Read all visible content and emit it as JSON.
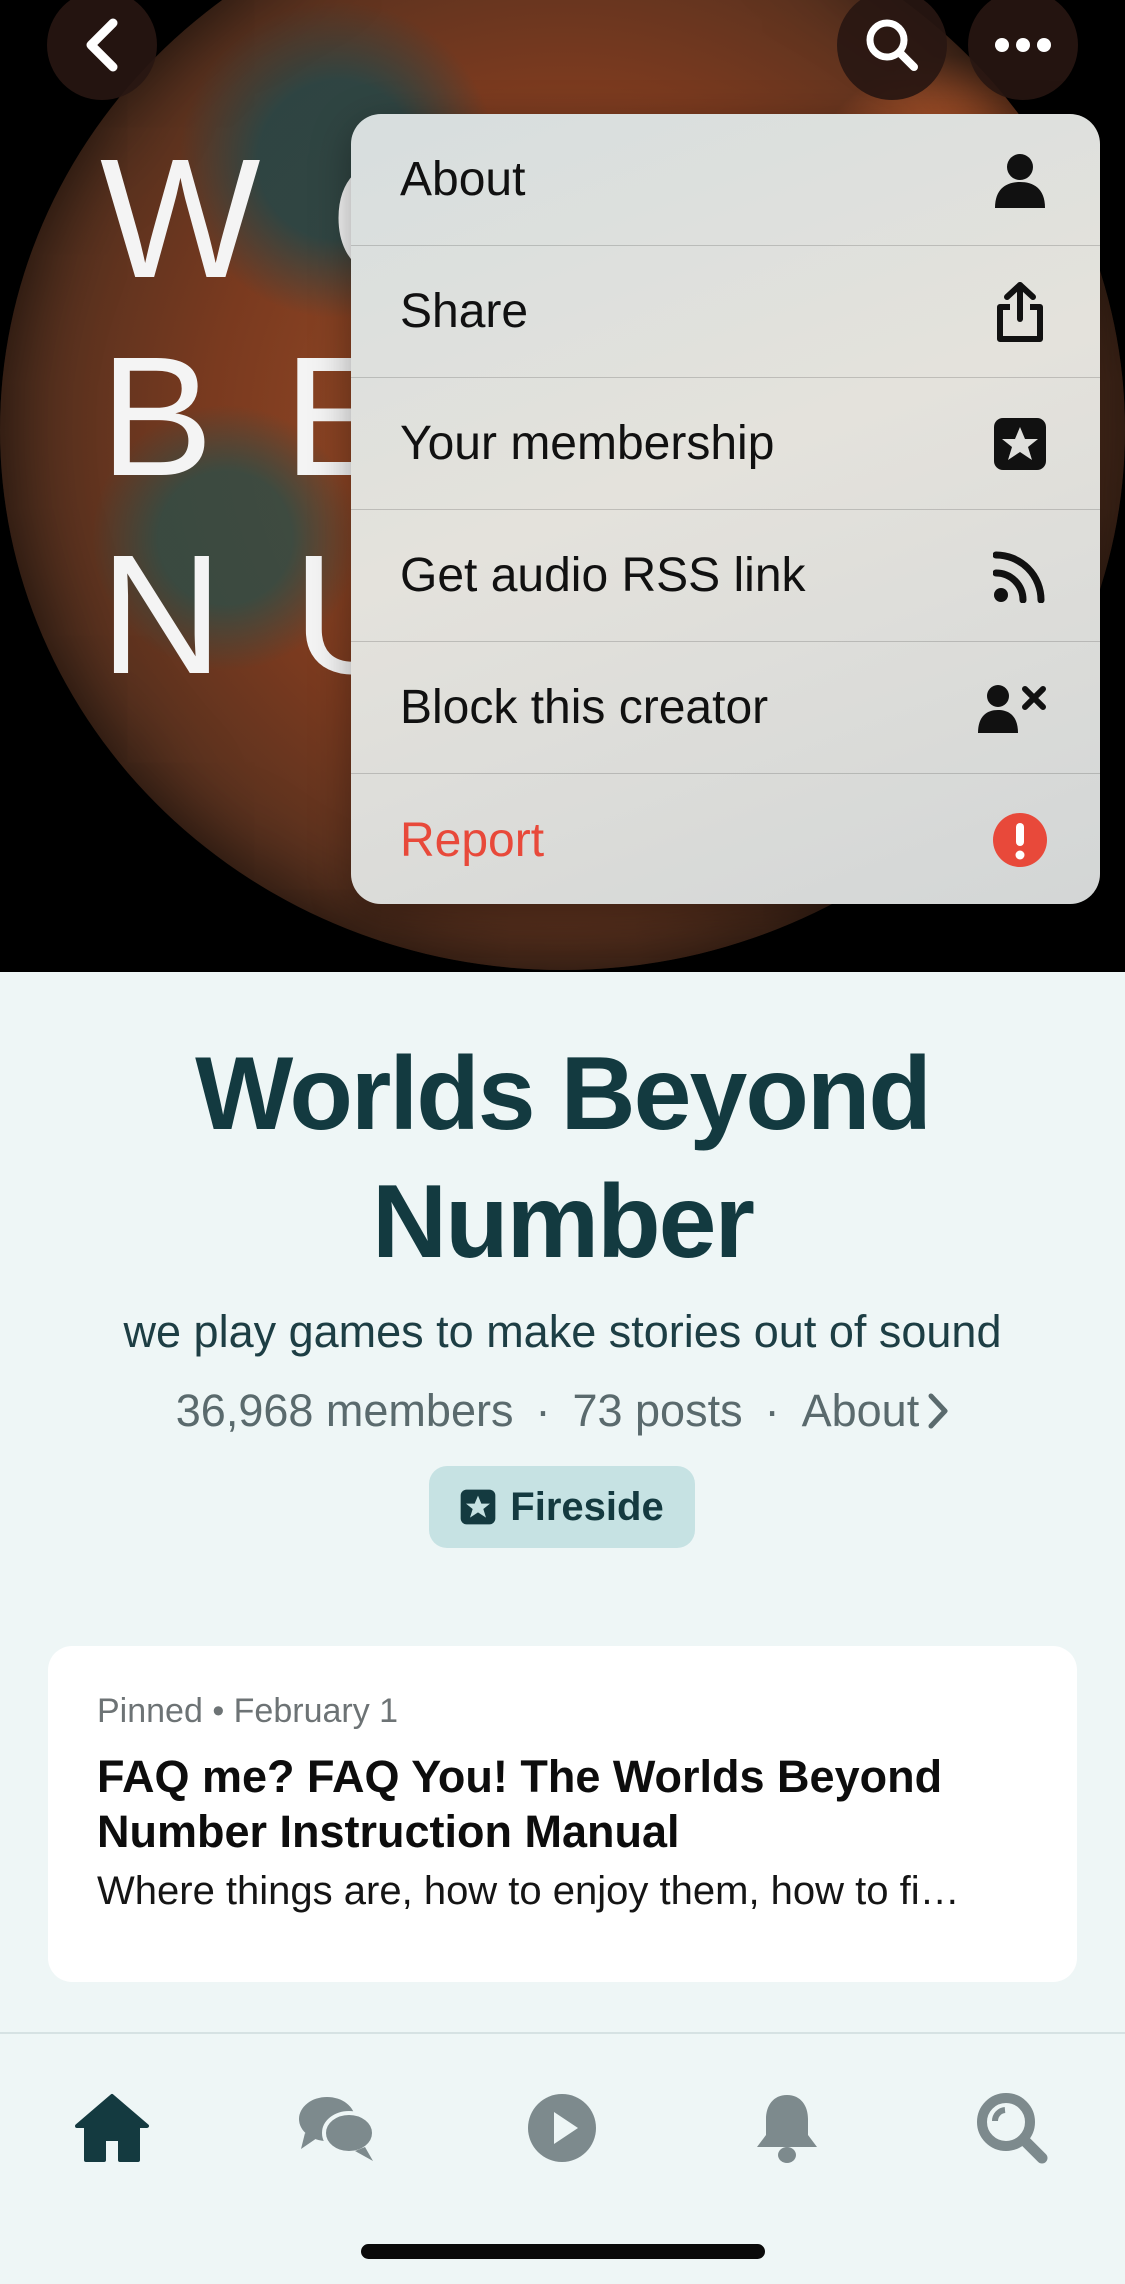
{
  "header": {
    "cover_letters": [
      "WO",
      "BE",
      "NU"
    ],
    "back_icon": "chevron-left-icon",
    "search_icon": "search-icon",
    "more_icon": "ellipsis-icon"
  },
  "menu": {
    "items": [
      {
        "label": "About",
        "icon": "person-icon"
      },
      {
        "label": "Share",
        "icon": "share-icon"
      },
      {
        "label": "Your membership",
        "icon": "star-badge-icon"
      },
      {
        "label": "Get audio RSS link",
        "icon": "rss-icon"
      },
      {
        "label": "Block this creator",
        "icon": "block-user-icon"
      },
      {
        "label": "Report",
        "icon": "exclamation-icon",
        "color": "#e8493a"
      }
    ]
  },
  "creator": {
    "title_line1": "Worlds Beyond",
    "title_line2": "Number",
    "tagline": "we play games to make stories out of sound",
    "members": "36,968 members",
    "posts": "73 posts",
    "about": "About",
    "separator": "·",
    "tier": "Fireside"
  },
  "pinned_post": {
    "meta": "Pinned • February 1",
    "title": "FAQ me? FAQ You! The Worlds Beyond Number Instruction Manual",
    "excerpt": "Where things are, how to enjoy them, how to fi…"
  },
  "bottom_nav": {
    "items": [
      {
        "name": "home",
        "icon": "home-icon",
        "active": true
      },
      {
        "name": "chats",
        "icon": "chat-bubbles-icon",
        "active": false
      },
      {
        "name": "play",
        "icon": "play-icon",
        "active": false
      },
      {
        "name": "notifications",
        "icon": "bell-icon",
        "active": false
      },
      {
        "name": "search",
        "icon": "search-icon",
        "active": false
      }
    ]
  },
  "colors": {
    "accent": "#143a40",
    "danger": "#e8493a",
    "badge_bg": "#c6e2e3",
    "page_bg": "#eef6f6"
  }
}
